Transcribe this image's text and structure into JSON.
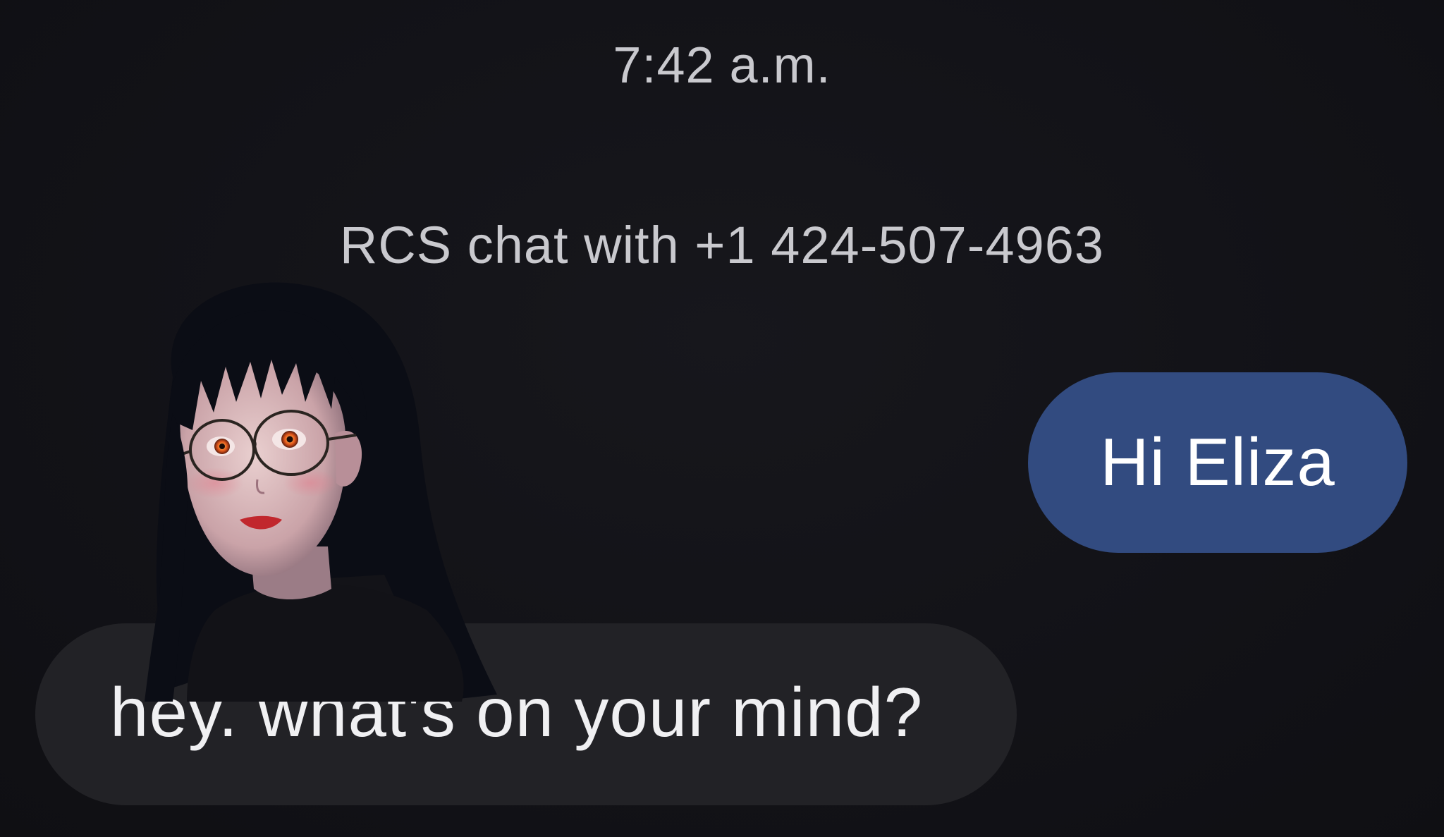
{
  "conversation": {
    "timestamp": "7:42 a.m.",
    "chat_info": "RCS chat with +1 424-507-4963"
  },
  "messages": [
    {
      "direction": "outgoing",
      "text": "Hi Eliza"
    },
    {
      "direction": "incoming",
      "text": "hey. what's on your mind?"
    }
  ],
  "colors": {
    "background": "#121217",
    "outgoing_bubble": "#324b80",
    "incoming_bubble": "#222226",
    "meta_text": "#c9c9ce"
  },
  "avatar": {
    "icon": "contact-avatar-illustration"
  }
}
